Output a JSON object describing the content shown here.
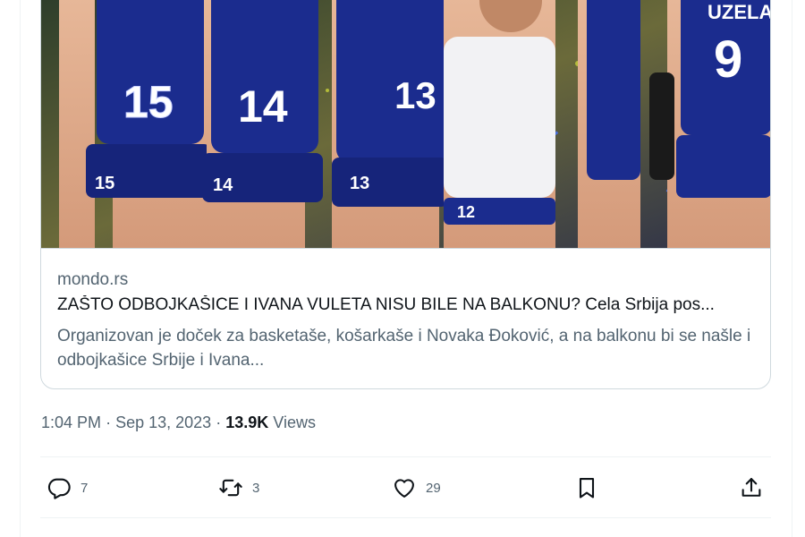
{
  "card": {
    "domain": "mondo.rs",
    "title": "ZAŠTO ODBOJKAŠICE I IVANA VULETA NISU BILE NA BALKONU? Cela Srbija pos...",
    "description": "Organizovan je doček za basketaše, košarkaše i Novaka Đoković, a na balkonu bi se našle i odbojkašice Srbije i Ivana...",
    "image": {
      "jersey_numbers": [
        "15",
        "14",
        "13",
        "12",
        "9"
      ],
      "jersey_name": "UZELAC"
    }
  },
  "meta": {
    "time": "1:04 PM",
    "separator": "·",
    "date": "Sep 13, 2023",
    "views_count": "13.9K",
    "views_label": "Views"
  },
  "actions": {
    "reply_count": "7",
    "retweet_count": "3",
    "like_count": "29"
  },
  "colors": {
    "text_primary": "#0f1419",
    "text_secondary": "#536471",
    "border": "#cfd9de",
    "jersey_blue": "#1b2c8e"
  }
}
